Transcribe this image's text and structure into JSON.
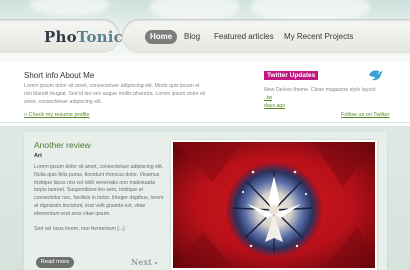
{
  "header": {
    "logo_part1": "Pho",
    "logo_part2": "Tonic",
    "nav": [
      "Home",
      "Blog",
      "Featured articles",
      "My Recent Projects"
    ]
  },
  "intro": {
    "title": "Short info About Me",
    "text": "Lorem ipsum dolor sit amet, consectetuer adipiscing elit. Morbi quis ipsum et nisi blandit feugiat. Sed id leo nec augue mollis pharetra. Lorem ipsum dolor sit amet, consectetuer adipiscing elit.",
    "link": "Check my resume profile"
  },
  "twitter": {
    "badge": "Twitter Updates",
    "text": "New Deluxe theme. Clean magazine style layout",
    "text_link": "..tw",
    "time": "days ago",
    "follow": "Follow us on Twitter"
  },
  "review": {
    "title": "Another review",
    "label": "Art",
    "body": "Lorem ipsum dolor sit amet, consectetuer adipiscing elit. Nulla quis felis purus, tincidunt rhoncus dolor. Vivamus tristique lacus nisi vel nibh venenatis non malesuada turpis laoreet. Suspendisse leo sem, tristique at consectetur nec, facilisis in tortor. Integer dapibus, lorem at dignissim tincidunt, erat velit gravida est, vitae elementum erat eros vitae ipsum.",
    "extra": "Sed vel risus lorem, non fermentum [...]",
    "read_more": "Read more",
    "next": "Next"
  },
  "colors": {
    "twitter_badge": "#c21883",
    "link_green": "#5a8a2a",
    "header_accent": "#5c7f92"
  },
  "icons": {
    "twitter_bird": "twitter-bird-icon"
  }
}
